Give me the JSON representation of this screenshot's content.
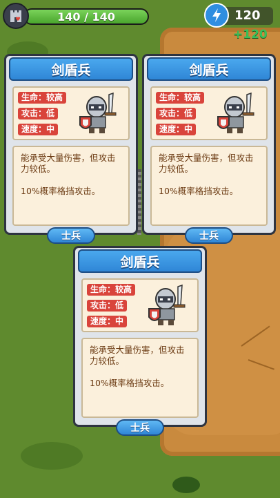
{
  "hud": {
    "health_text": "140 / 140",
    "health_fraction": 1.0,
    "energy_value": "120",
    "energy_bonus": "+120"
  },
  "cards": [
    {
      "title": "剑盾兵",
      "stats": [
        "生命：较高",
        "攻击：低",
        "速度：中"
      ],
      "desc_line1": "能承受大量伤害，但攻击力较低。",
      "desc_line2": "10%概率格挡攻击。",
      "type": "士兵"
    },
    {
      "title": "剑盾兵",
      "stats": [
        "生命：较高",
        "攻击：低",
        "速度：中"
      ],
      "desc_line1": "能承受大量伤害，但攻击力较低。",
      "desc_line2": "10%概率格挡攻击。",
      "type": "士兵"
    },
    {
      "title": "剑盾兵",
      "stats": [
        "生命：较高",
        "攻击：低",
        "速度：中"
      ],
      "desc_line1": "能承受大量伤害，但攻击力较低。",
      "desc_line2": "10%概率格挡攻击。",
      "type": "士兵"
    }
  ],
  "colors": {
    "grass": "#5f8a2e",
    "dirt": "#c98a3e",
    "header_blue": "#2f86d6",
    "stat_red": "#d9443b",
    "panel_cream": "#fbf0dc",
    "desc_text": "#6b3a12"
  }
}
